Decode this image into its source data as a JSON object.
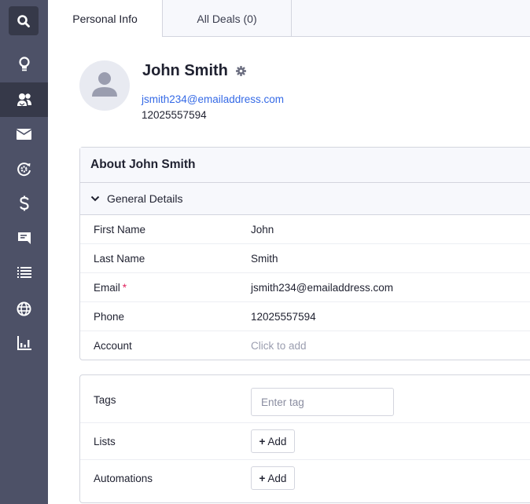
{
  "sidebar": {
    "items": [
      {
        "name": "search",
        "icon": "search-icon"
      },
      {
        "name": "ideas",
        "icon": "lightbulb-icon"
      },
      {
        "name": "contacts",
        "icon": "contacts-icon",
        "active": true
      },
      {
        "name": "campaigns",
        "icon": "envelope-icon"
      },
      {
        "name": "automations",
        "icon": "automation-cycle-icon"
      },
      {
        "name": "deals",
        "icon": "dollar-icon"
      },
      {
        "name": "conversations",
        "icon": "chat-icon"
      },
      {
        "name": "lists",
        "icon": "list-icon"
      },
      {
        "name": "website",
        "icon": "globe-icon"
      },
      {
        "name": "reports",
        "icon": "bar-chart-icon"
      }
    ]
  },
  "tabs": [
    {
      "label": "Personal Info",
      "active": true
    },
    {
      "label": "All Deals (0)",
      "active": false
    }
  ],
  "contact": {
    "name": "John Smith",
    "email": "jsmith234@emailaddress.com",
    "phone": "12025557594"
  },
  "about": {
    "title": "About John Smith",
    "section_label": "General Details",
    "fields": [
      {
        "label": "First Name",
        "value": "John",
        "required": false
      },
      {
        "label": "Last Name",
        "value": "Smith",
        "required": false
      },
      {
        "label": "Email",
        "value": "jsmith234@emailaddress.com",
        "required": true,
        "required_mark": "*"
      },
      {
        "label": "Phone",
        "value": "12025557594",
        "required": false
      },
      {
        "label": "Account",
        "value": "Click to add",
        "placeholder": true
      }
    ]
  },
  "extras": {
    "tags_label": "Tags",
    "tags_placeholder": "Enter tag",
    "lists_label": "Lists",
    "automations_label": "Automations",
    "add_plus": "+",
    "add_label": "Add"
  },
  "colors": {
    "sidebar_bg": "#4d5167",
    "sidebar_active": "#363949",
    "link": "#356ae6",
    "required": "#e0245e"
  }
}
